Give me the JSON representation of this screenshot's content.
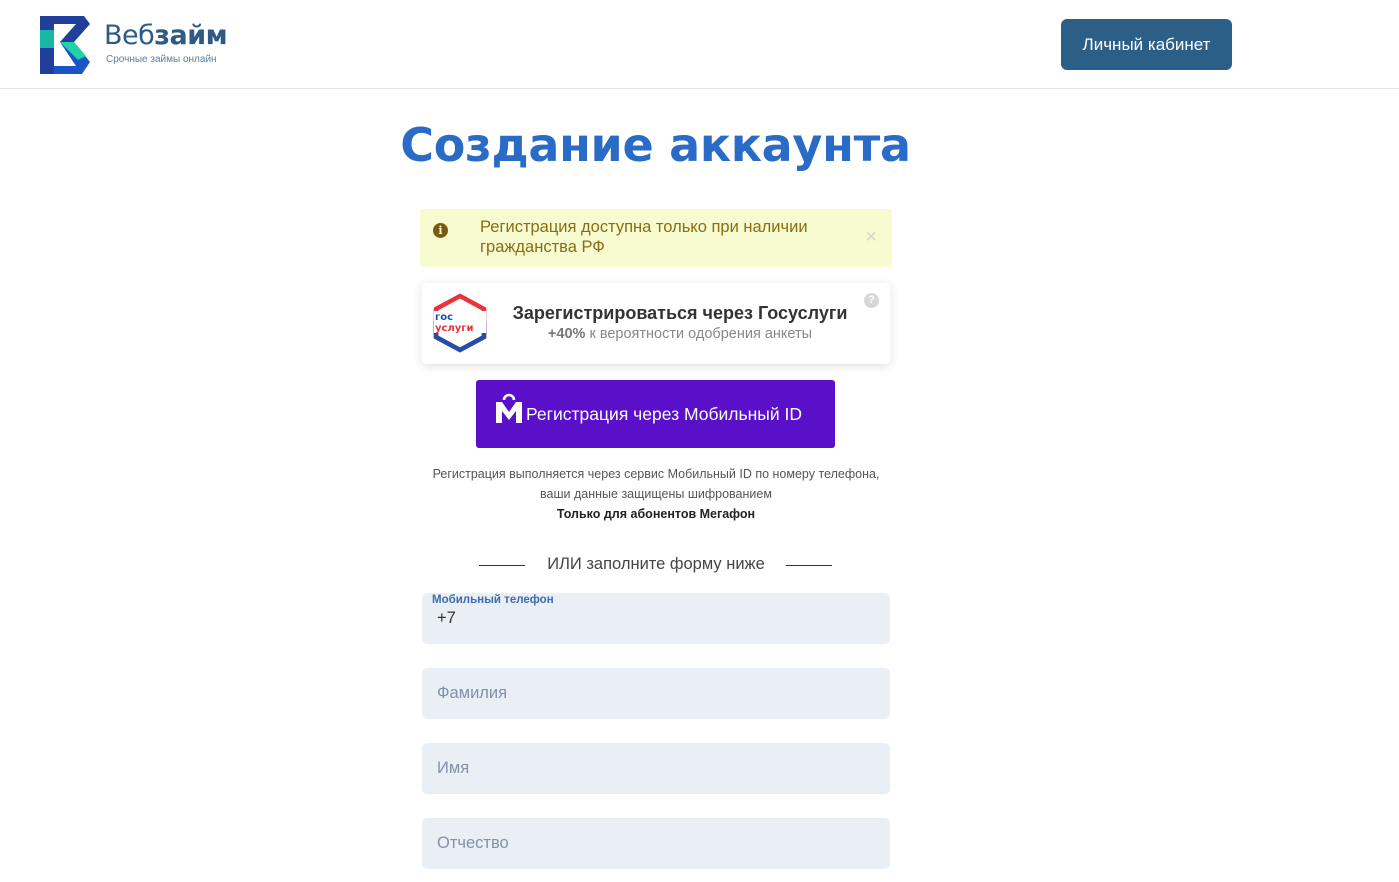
{
  "header": {
    "logo_name_pre": "Веб",
    "logo_name_bold": "займ",
    "logo_tagline": "Срочные займы онлайн",
    "cabinet_button": "Личный кабинет"
  },
  "page_title": "Создание аккаунта",
  "alert": {
    "text": "Регистрация доступна только при наличии гражданства РФ",
    "close_symbol": "×",
    "info_symbol": "i"
  },
  "gosuslugi": {
    "logo_line1": "гос",
    "logo_line2": "услуги",
    "title": "Зарегистрироваться через Госуслуги",
    "sub_bold": "+40%",
    "sub_text": " к вероятности одобрения анкеты",
    "help_symbol": "?"
  },
  "mobile_id": {
    "button_label": "Регистрация через Мобильный ID",
    "note_line1": "Регистрация выполняется через сервис Мобильный ID по номеру телефона, ваши данные защищены шифрованием",
    "note_bold": "Только для абонентов Мегафон"
  },
  "divider_text": "ИЛИ заполните форму ниже",
  "form": {
    "phone_label": "Мобильный телефон",
    "phone_value": "+7",
    "last_name_placeholder": "Фамилия",
    "first_name_placeholder": "Имя",
    "middle_name_placeholder": "Отчество"
  },
  "colors": {
    "brand": "#2c5f87",
    "title": "#2a6bc8",
    "mobile_id": "#5a0fc8",
    "alert_bg": "#f6fbd0",
    "field_bg": "#eaeff5"
  }
}
